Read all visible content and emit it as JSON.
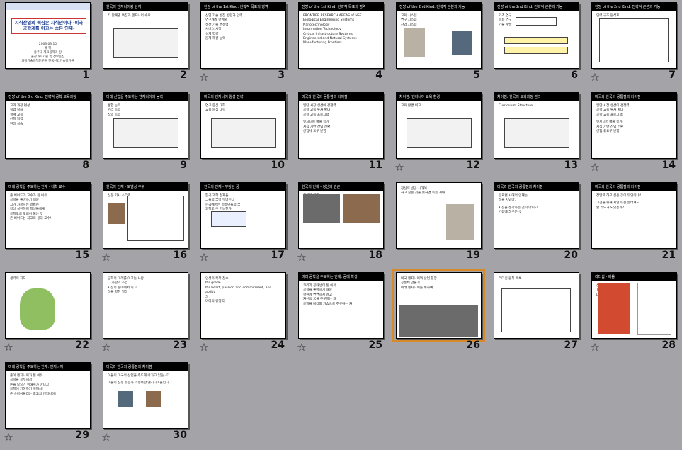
{
  "slides": [
    {
      "number": "1",
      "header": "",
      "title": "지식산업의 핵심은 지식인이다 -미국 공학계를 이끄는 숨은 인재-",
      "lines": [
        "2003.03.10",
        "류 혁",
        "충주대 재료공학과 강",
        "울산과학기술 및 정보통신",
        "과학기술정책연구원 한국산업기술평가원"
      ],
      "star": false
    },
    {
      "number": "2",
      "header": "한국의 엔지니어링 단계",
      "lines": [
        "각 단계별 특징과 엔지니어 수요"
      ],
      "star": false
    },
    {
      "number": "3",
      "header": "전망 of the 1st Kind: 전략적 목표의 영역",
      "lines": [
        "산업 기술 발전 방향과 인력",
        "연구개발 단계별",
        "생산 기술 경쟁력",
        "서비스 시장",
        "설계 역량",
        "문제 해결 능력"
      ],
      "star": true
    },
    {
      "number": "4",
      "header": "전망 of the 1st Kind: 전략적 목표의 영역",
      "lines": [
        "FRONTIER RESEARCH AREAS of NSF",
        "Biological Engineering Systems",
        "Nanotechnology",
        "Information Technology",
        "Critical Infrastructure Systems",
        "Engineered and Natural Systems",
        "Manufacturing Frontiers"
      ],
      "star": false
    },
    {
      "number": "5",
      "header": "전망 of the 2nd Kind: 전략적 근본의 기능",
      "lines": [
        "교육 시스템",
        "연구 시스템",
        "산업 시스템"
      ],
      "star": false
    },
    {
      "number": "6",
      "header": "전망 of the 2nd Kind: 전략적 근본의 기능",
      "lines": [
        "기초 연구",
        "응용 연구",
        "기술 개발"
      ],
      "star": false
    },
    {
      "number": "7",
      "header": "전망 of the 2nd Kind: 전략적 근본의 기능",
      "lines": [
        "인력 구조 분석표"
      ],
      "star": true
    },
    {
      "number": "8",
      "header": "전망 of the 3rd Kind: 전략적 공학 교육과정",
      "lines": [
        "교과 과정 편성",
        "실험 실습",
        "설계 교육",
        "산학 협력",
        "현장 실습"
      ],
      "star": false
    },
    {
      "number": "9",
      "header": "미래 산업을 주도하는 엔지니어의 능력",
      "lines": [
        "통합 능력",
        "관리 능력",
        "창의 능력"
      ],
      "star": false
    },
    {
      "number": "10",
      "header": "미국의 엔지니어 양성 전략",
      "lines": [
        "연구 중심 대학",
        "교육 중심 대학"
      ],
      "star": false
    },
    {
      "number": "11",
      "header": "미국과 한국의 공통점과 차이점",
      "lines": [
        "일단 시장 생산이 경쟁력",
        "공학 교육 투자 확대",
        "공학 교육 프로그램",
        "",
        "엔지니어 배출 증가",
        "지식 기반 산업 전환",
        "산업체 요구 반영"
      ],
      "star": false
    },
    {
      "number": "12",
      "header": "차이점: 엔지니어 교육 환경",
      "lines": [
        "교육 환경 비교"
      ],
      "star": true
    },
    {
      "number": "13",
      "header": "차이점: 한국의 교과과정 관리",
      "lines": [
        "Curriculum Structure"
      ],
      "star": false
    },
    {
      "number": "14",
      "header": "미국과 한국의 공통점과 차이점",
      "lines": [
        "일단 시장 생산이 경쟁력",
        "공학 교육 투자 확대",
        "공학 교육 프로그램",
        "",
        "엔지니어 배출 증가",
        "지식 기반 산업 전환",
        "산업체 요구 반영"
      ],
      "star": true
    },
    {
      "number": "15",
      "header": "미래 공학을 주도하는 인재 - 대학 교수",
      "lines": [
        "존 비어드가 교수가 된 이유",
        "공학을 좋아하기 때문",
        "그가 가르치는 방법은",
        "항상 실천하며 학생들에게",
        "공학도의 모범이 되는 것",
        "존 비어드는 최고의 공대 교수!"
      ],
      "star": false
    },
    {
      "number": "16",
      "header": "한국의 인재 - 모범상 추구",
      "lines": [
        "신문 기사 스크랩"
      ],
      "star": true
    },
    {
      "number": "17",
      "header": "한국의 인재 - 부정된 꿈",
      "lines": [
        "한국 과학 천재들",
        "그들의 꿈이 무너진다",
        "한국에서는 청소년들의 꿈",
        "과학도 주 가능한가"
      ],
      "star": true
    },
    {
      "number": "18",
      "header": "한국의 인재 - 정신의 빈곤",
      "lines": [
        "이공계 기피",
        "의대 선호",
        "공학자의 현실"
      ],
      "star": true
    },
    {
      "number": "19",
      "header": "",
      "lines": [
        "정신의 빈곤 시대에",
        "하고 싶은 것을 못하면 죽는 시대"
      ],
      "star": false
    },
    {
      "number": "20",
      "header": "미국과 한국의 공통점과 차이점",
      "lines": [
        "글로벌 시대의 인재는",
        "꿈을 지녔다.",
        "",
        "자신을 생각하는 것이 아니고",
        "가슴에 꿈꾸는 것"
      ],
      "star": false
    },
    {
      "number": "21",
      "header": "미국과 한국의 공통점과 차이점",
      "lines": [
        "정말로 하고 싶은 것이 무엇이냐?",
        "",
        "그것을 위해 치열히 온 몸바쳐도",
        "할 각오가 되었는가?"
      ],
      "star": false
    },
    {
      "number": "22",
      "header": "",
      "lines": [
        "생각의 지도"
      ],
      "star": true
    },
    {
      "number": "23",
      "header": "",
      "lines": [
        "공학의 미래를 이끄는 사람",
        "그 사람의 조건",
        "자신의 분야에서 최고",
        "꿈을 향한 열정"
      ],
      "star": true
    },
    {
      "number": "24",
      "header": "",
      "lines": [
        "인생의 목적 점수",
        "It's grade",
        "It's heart, passion and commitment, and ability",
        "꿈",
        "미래의 경쟁력"
      ],
      "star": true
    },
    {
      "number": "25",
      "header": "미래 공학을 주도하는 인재: 공대 학생",
      "lines": [
        "코리가 공대생이 된 이유",
        "공학을 좋아하기 때문",
        "학원에 연연하지 않고",
        "자신의 꿈을 추구하는 자",
        "공학을 바라와 가슴으로 추구하는 자"
      ],
      "star": true
    },
    {
      "number": "26",
      "header": "",
      "lines": [
        "미국 엔지니어와 산업 현장",
        "공동체 만들기",
        "미래 엔지니어를 위하여"
      ],
      "star": false
    },
    {
      "number": "27",
      "header": "",
      "lines": [
        "리더십 원칙 목록"
      ],
      "star": false
    },
    {
      "number": "28",
      "header": "리더쉽 - 배움",
      "lines": [
        "섬기는 리더",
        "THE SERVANT",
        "LEADERSHIP"
      ],
      "star": true
    },
    {
      "number": "29",
      "header": "미래 공학을 주도하는 인재: 엔지니어",
      "lines": [
        "존이 엔지니어가 된 이유",
        "공학을 공부해서",
        "돈을 모으기 위해서가 아니고",
        "공학에 기여하기 위해서!",
        "존 슈마이들러는 최고의 엔지니어!"
      ],
      "star": true
    },
    {
      "number": "30",
      "header": "미국과 한국의 공통점과 차이점",
      "lines": [
        "이들이 미국의 산업을 주도해 나가고 있습니다.",
        "",
        "이들이 진정 유능하고 행복한 엔지니어들입니다."
      ],
      "star": true
    }
  ],
  "selected_slide": "26",
  "colors": {
    "background": "#a3a3a8",
    "selection": "#d88a2a",
    "header": "#000000",
    "title_blue": "#1a3c8f"
  }
}
